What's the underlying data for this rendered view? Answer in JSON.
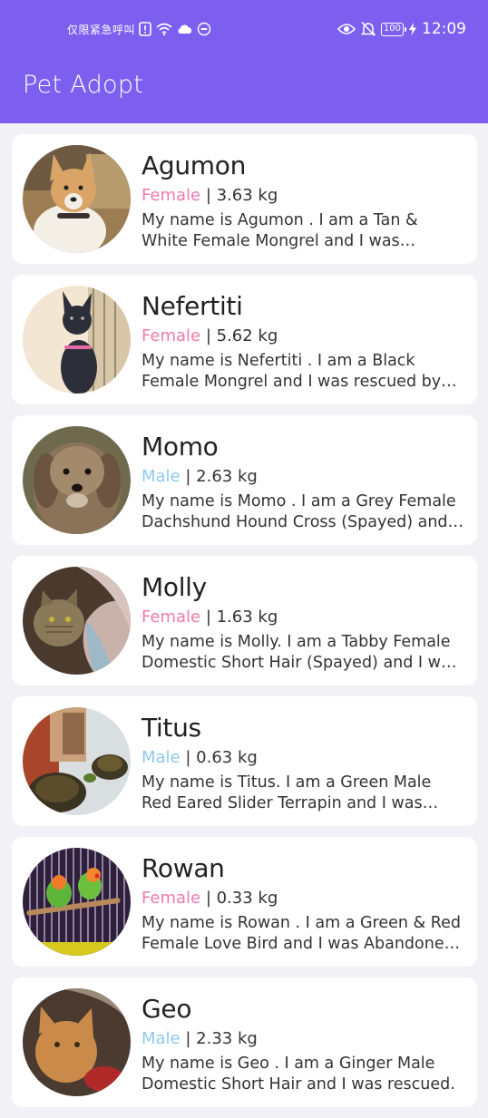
{
  "status_bar": {
    "carrier_text": "仅限紧急呼叫",
    "battery": "100",
    "time": "12:09",
    "icons": [
      "alert-sim-icon",
      "wifi-icon",
      "cloud-icon",
      "hd-icon",
      "eye-icon",
      "bell-off-icon",
      "battery-icon",
      "charging-icon"
    ]
  },
  "app_bar": {
    "title": "Pet Adopt"
  },
  "colors": {
    "primary": "#7d5ff0",
    "female": "#f07aa9",
    "male": "#8cc9ef"
  },
  "pets": [
    {
      "name": "Agumon",
      "gender": "Female",
      "weight": "3.63 kg",
      "description": "My name is Agumon . I am a Tan & White Female Mongrel and I was rescued and brought to the shelter.",
      "image": "tan-white-dog-photo"
    },
    {
      "name": "Nefertiti",
      "gender": "Female",
      "weight": "5.62 kg",
      "description": "My name is Nefertiti . I am a Black Female Mongrel and I was rescued by local volunteers.",
      "image": "black-dog-photo"
    },
    {
      "name": "Momo",
      "gender": "Male",
      "weight": "2.63 kg",
      "description": "My name is Momo . I am a Grey Female Dachshund Hound Cross (Spayed) and I am waiting for a home.",
      "image": "grey-dachshund-photo"
    },
    {
      "name": "Molly",
      "gender": "Female",
      "weight": "1.63 kg",
      "description": "My name is Molly. I am a Tabby Female Domestic Short Hair (Spayed) and I was abandoned.",
      "image": "tabby-cat-photo"
    },
    {
      "name": "Titus",
      "gender": "Male",
      "weight": "0.63 kg",
      "description": "My name is Titus. I am a Green Male Red Eared Slider Terrapin and I was Abandoned by my owner.",
      "image": "terrapin-photo"
    },
    {
      "name": "Rowan",
      "gender": "Female",
      "weight": "0.33 kg",
      "description": "My name is Rowan . I am a Green & Red Female Love Bird and I was Abandoned by my owner.",
      "image": "lovebird-photo"
    },
    {
      "name": "Geo",
      "gender": "Male",
      "weight": "2.33 kg",
      "description": "My name is Geo . I am a Ginger Male Domestic Short Hair and I was rescued.",
      "image": "ginger-cat-photo"
    }
  ]
}
